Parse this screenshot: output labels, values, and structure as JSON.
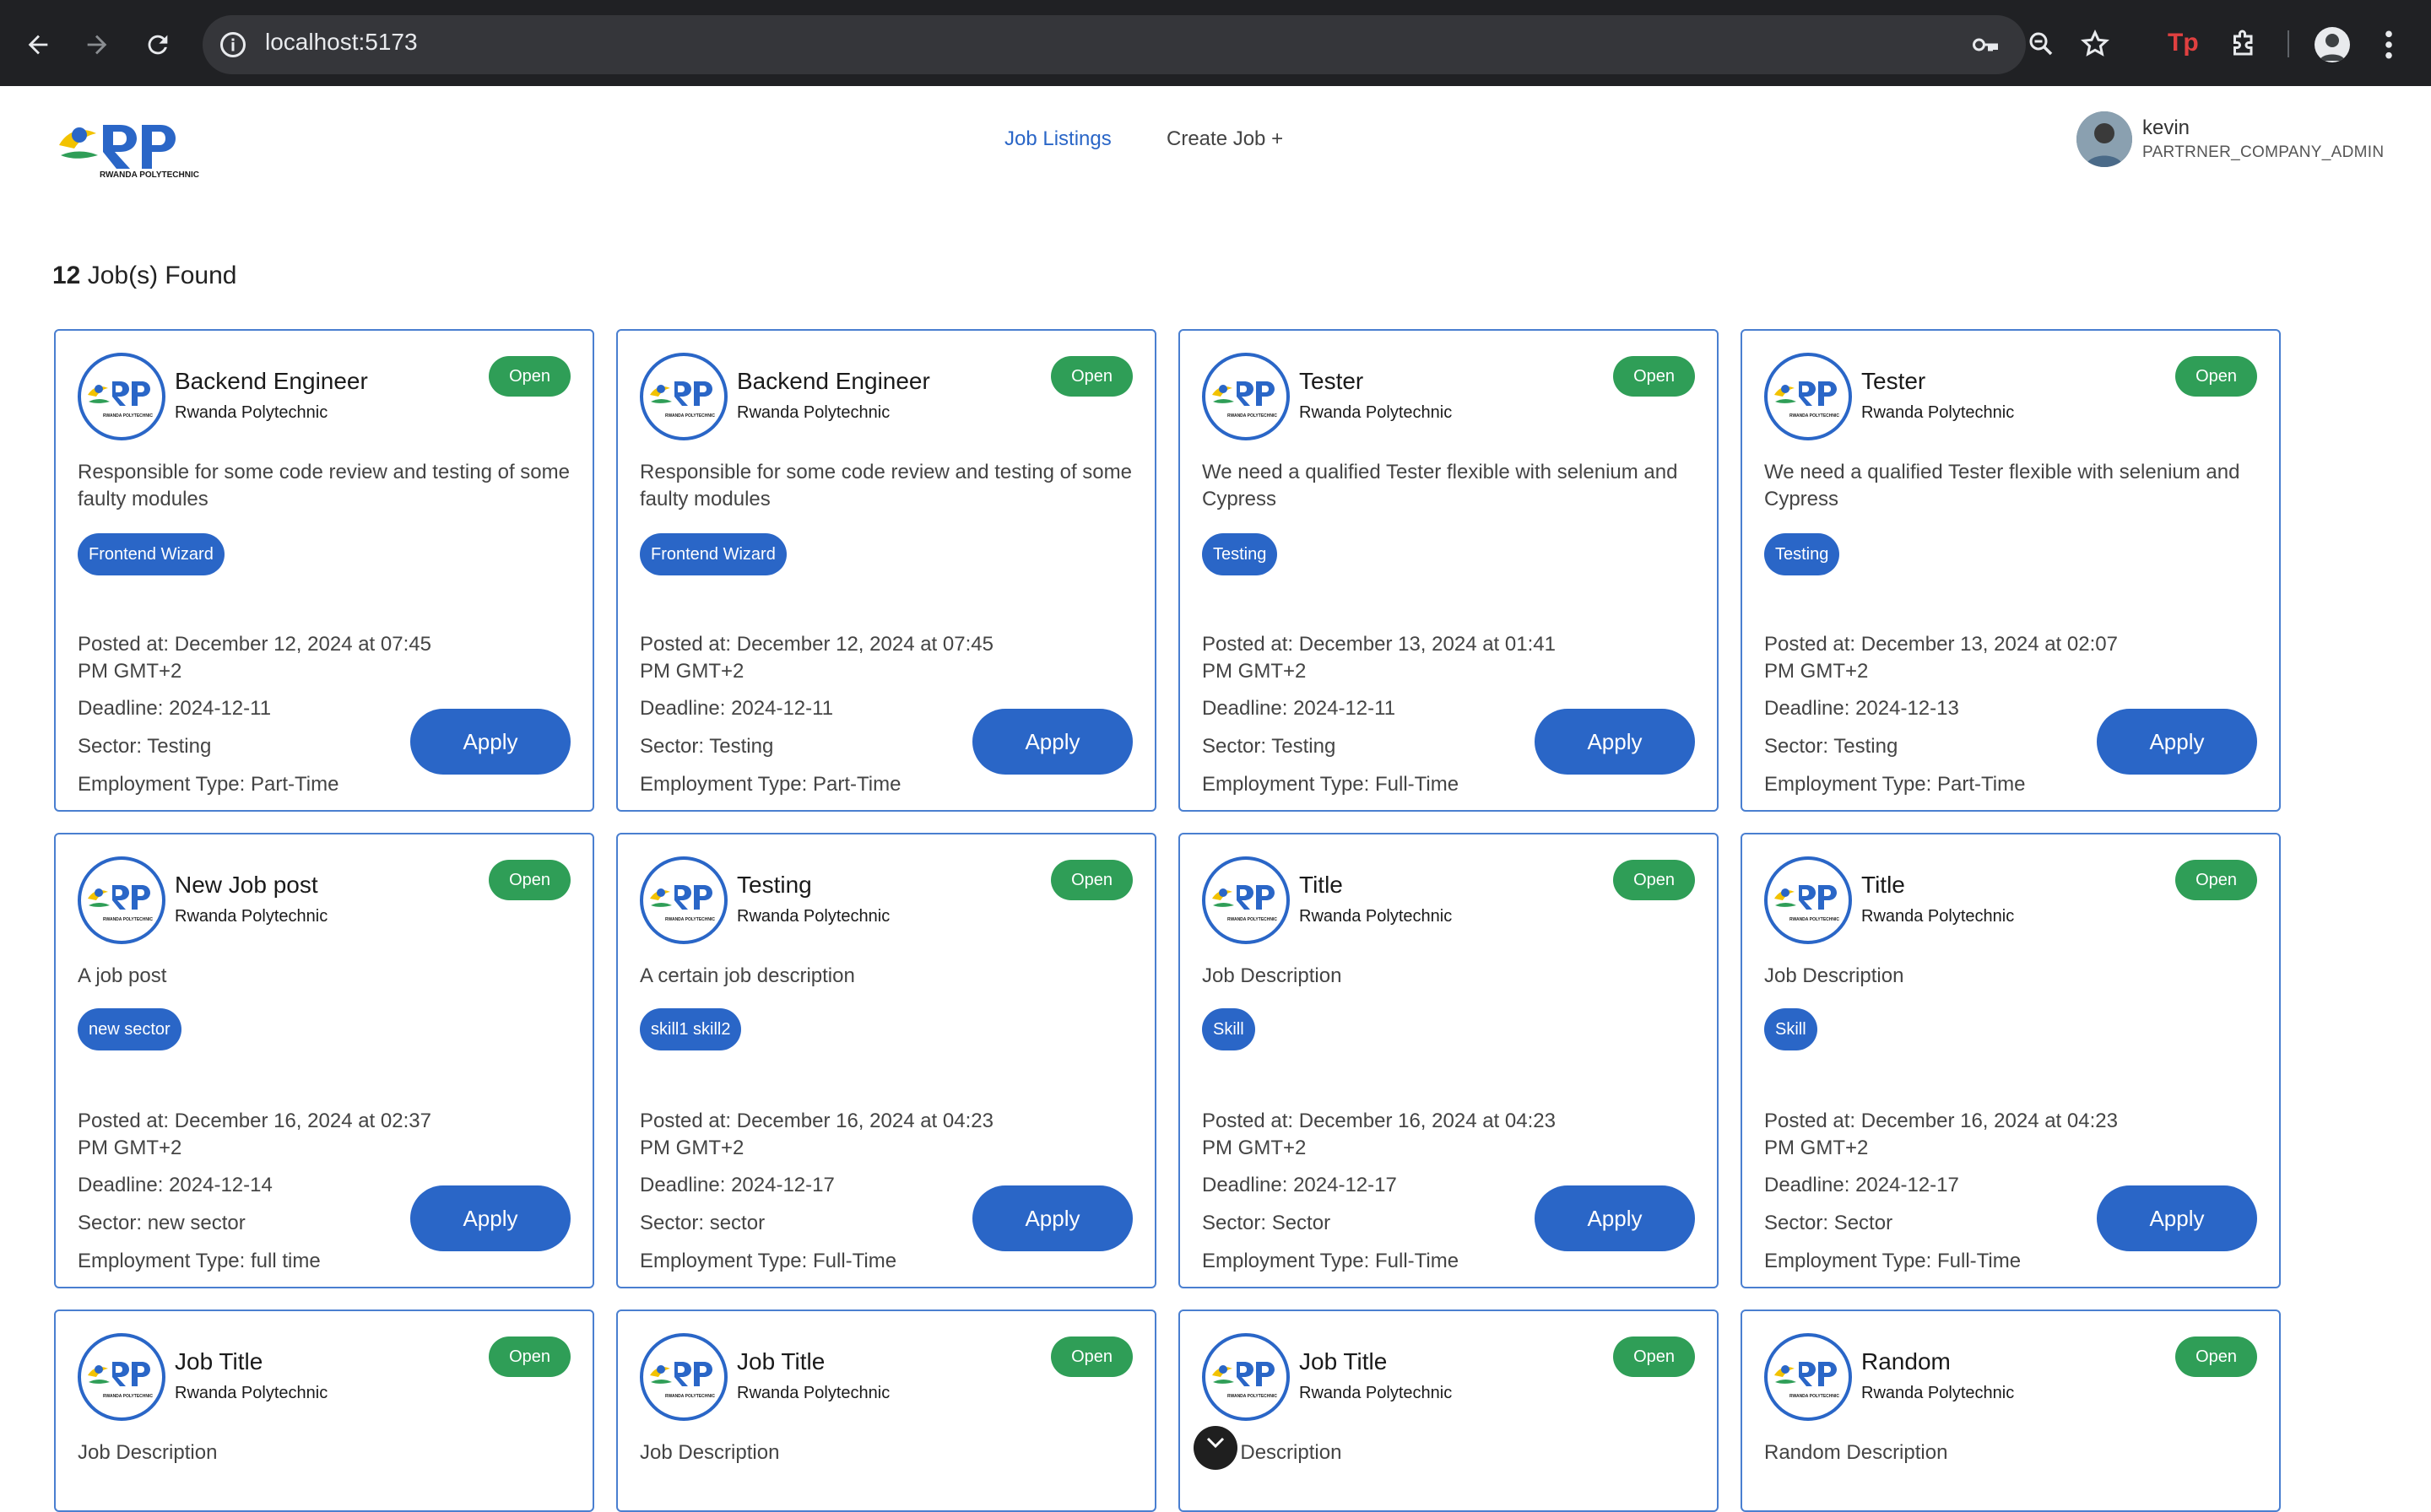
{
  "browser": {
    "url": "localhost:5173"
  },
  "header": {
    "nav": [
      {
        "label": "Job Listings",
        "active": true
      },
      {
        "label": "Create Job +",
        "active": false
      }
    ],
    "user": {
      "name": "kevin",
      "role": "PARTRNER_COMPANY_ADMIN"
    }
  },
  "results": {
    "count": "12",
    "count_label": "Job(s) Found"
  },
  "colors": {
    "primary": "#2a66c7",
    "status_open": "#2f9e57",
    "card_border": "#4a7fd0"
  },
  "apply_label": "Apply",
  "jobs": [
    {
      "title": "Backend Engineer",
      "company": "Rwanda Polytechnic",
      "status": "Open",
      "description": "Responsible for some code review and testing of some faulty modules",
      "skill": "Frontend Wizard",
      "posted": "Posted at: December 12, 2024 at 07:45 PM GMT+2",
      "deadline": "Deadline: 2024-12-11",
      "sector": "Sector: Testing",
      "employment": "Employment Type: Part-Time"
    },
    {
      "title": "Backend Engineer",
      "company": "Rwanda Polytechnic",
      "status": "Open",
      "description": "Responsible for some code review and testing of some faulty modules",
      "skill": "Frontend Wizard",
      "posted": "Posted at: December 12, 2024 at 07:45 PM GMT+2",
      "deadline": "Deadline: 2024-12-11",
      "sector": "Sector: Testing",
      "employment": "Employment Type: Part-Time"
    },
    {
      "title": "Tester",
      "company": "Rwanda Polytechnic",
      "status": "Open",
      "description": "We need a qualified Tester flexible with selenium and Cypress",
      "skill": "Testing",
      "posted": "Posted at: December 13, 2024 at 01:41 PM GMT+2",
      "deadline": "Deadline: 2024-12-11",
      "sector": "Sector: Testing",
      "employment": "Employment Type: Full-Time"
    },
    {
      "title": "Tester",
      "company": "Rwanda Polytechnic",
      "status": "Open",
      "description": "We need a qualified Tester flexible with selenium and Cypress",
      "skill": "Testing",
      "posted": "Posted at: December 13, 2024 at 02:07 PM GMT+2",
      "deadline": "Deadline: 2024-12-13",
      "sector": "Sector: Testing",
      "employment": "Employment Type: Part-Time"
    },
    {
      "title": "New Job post",
      "company": "Rwanda Polytechnic",
      "status": "Open",
      "description": "A job post",
      "skill": "new sector",
      "posted": "Posted at: December 16, 2024 at 02:37 PM GMT+2",
      "deadline": "Deadline: 2024-12-14",
      "sector": "Sector: new sector",
      "employment": "Employment Type: full time"
    },
    {
      "title": "Testing",
      "company": "Rwanda Polytechnic",
      "status": "Open",
      "description": "A certain job description",
      "skill": "skill1 skill2",
      "posted": "Posted at: December 16, 2024 at 04:23 PM GMT+2",
      "deadline": "Deadline: 2024-12-17",
      "sector": "Sector: sector",
      "employment": "Employment Type: Full-Time"
    },
    {
      "title": "Title",
      "company": "Rwanda Polytechnic",
      "status": "Open",
      "description": "Job Description",
      "skill": "Skill",
      "posted": "Posted at: December 16, 2024 at 04:23 PM GMT+2",
      "deadline": "Deadline: 2024-12-17",
      "sector": "Sector: Sector",
      "employment": "Employment Type: Full-Time"
    },
    {
      "title": "Title",
      "company": "Rwanda Polytechnic",
      "status": "Open",
      "description": "Job Description",
      "skill": "Skill",
      "posted": "Posted at: December 16, 2024 at 04:23 PM GMT+2",
      "deadline": "Deadline: 2024-12-17",
      "sector": "Sector: Sector",
      "employment": "Employment Type: Full-Time"
    },
    {
      "title": "Job Title",
      "company": "Rwanda Polytechnic",
      "status": "Open",
      "description": "Job Description"
    },
    {
      "title": "Job Title",
      "company": "Rwanda Polytechnic",
      "status": "Open",
      "description": "Job Description"
    },
    {
      "title": "Job Title",
      "company": "Rwanda Polytechnic",
      "status": "Open",
      "description": "Job Description"
    },
    {
      "title": "Random",
      "company": "Rwanda Polytechnic",
      "status": "Open",
      "description": "Random Description"
    }
  ]
}
